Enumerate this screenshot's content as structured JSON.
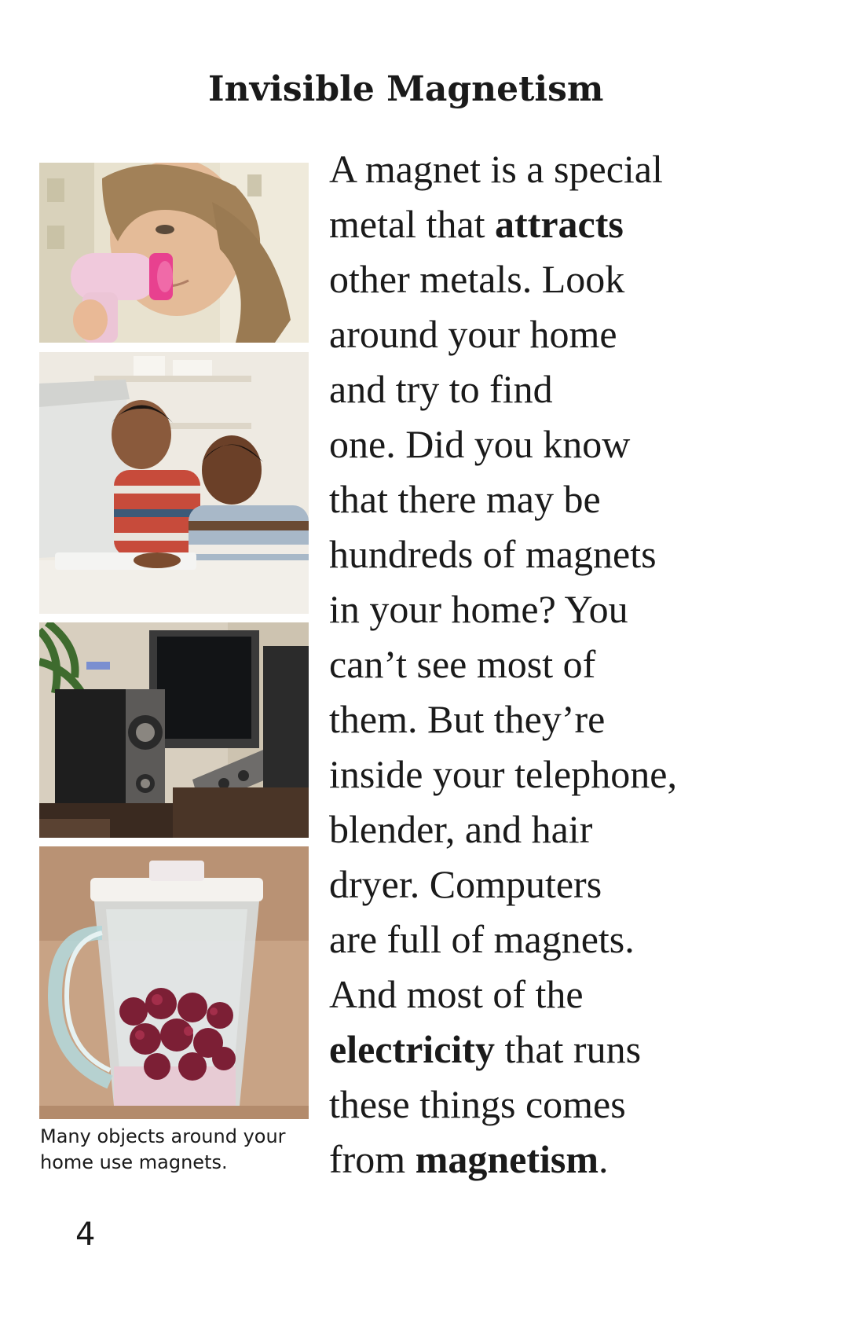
{
  "page": {
    "title": "Invisible Magnetism",
    "page_number": "4",
    "caption_lines": [
      "Many objects around your",
      "home use magnets."
    ],
    "body_lines": [
      [
        {
          "t": "A magnet is a special",
          "b": false
        }
      ],
      [
        {
          "t": "metal that ",
          "b": false
        },
        {
          "t": "attracts",
          "b": true
        }
      ],
      [
        {
          "t": "other metals. Look",
          "b": false
        }
      ],
      [
        {
          "t": "around your home",
          "b": false
        }
      ],
      [
        {
          "t": "and try to find",
          "b": false
        }
      ],
      [
        {
          "t": "one. Did you know",
          "b": false
        }
      ],
      [
        {
          "t": "that there may be",
          "b": false
        }
      ],
      [
        {
          "t": "hundreds of magnets",
          "b": false
        }
      ],
      [
        {
          "t": "in your home? You",
          "b": false
        }
      ],
      [
        {
          "t": "can’t see most of",
          "b": false
        }
      ],
      [
        {
          "t": "them. But they’re",
          "b": false
        }
      ],
      [
        {
          "t": "inside your telephone,",
          "b": false
        }
      ],
      [
        {
          "t": "blender, and hair",
          "b": false
        }
      ],
      [
        {
          "t": "dryer. Computers",
          "b": false
        }
      ],
      [
        {
          "t": "are full of magnets.",
          "b": false
        }
      ],
      [
        {
          "t": "And most of the",
          "b": false
        }
      ],
      [
        {
          "t": "electricity",
          "b": true
        },
        {
          "t": " that runs",
          "b": false
        }
      ],
      [
        {
          "t": "these things comes",
          "b": false
        }
      ],
      [
        {
          "t": "from ",
          "b": false
        },
        {
          "t": "magnetism",
          "b": true
        },
        {
          "t": ".",
          "b": false
        }
      ]
    ]
  },
  "colors": {
    "text": "#1a1a1a",
    "background": "#ffffff"
  }
}
